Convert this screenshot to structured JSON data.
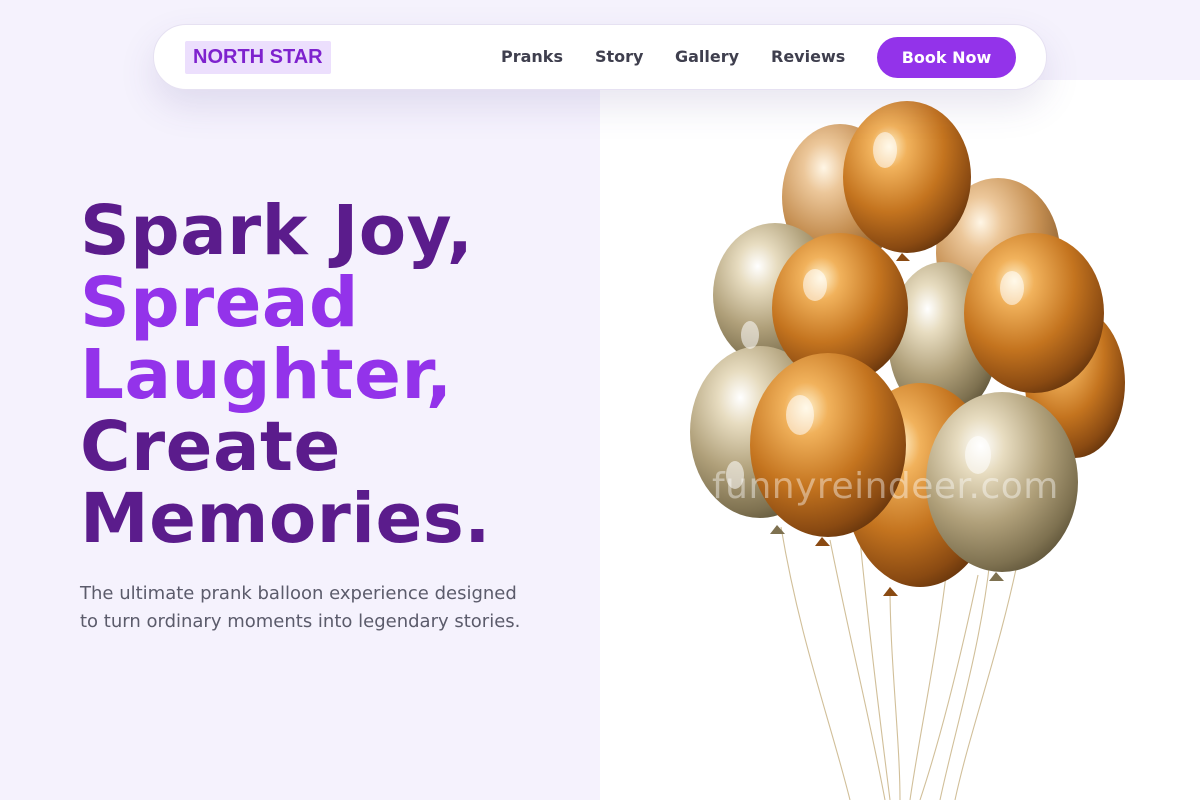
{
  "nav": {
    "logo": "NORTH STAR",
    "links": [
      "Pranks",
      "Story",
      "Gallery",
      "Reviews"
    ],
    "cta": "Book Now"
  },
  "hero": {
    "headline": [
      "Spark Joy,",
      "Spread",
      "Laughter,",
      "Create",
      "Memories."
    ],
    "subtext": "The ultimate prank balloon experience designed to turn ordinary moments into legendary stories.",
    "watermark": "funnyreindeer.com"
  },
  "colors": {
    "page_bg": "#f5f2fd",
    "accent": "#9333ea",
    "headline_dark": "#5b1c8c",
    "logo_bg": "#ecdffd"
  },
  "icons": {
    "image": "gold-balloons-image"
  }
}
